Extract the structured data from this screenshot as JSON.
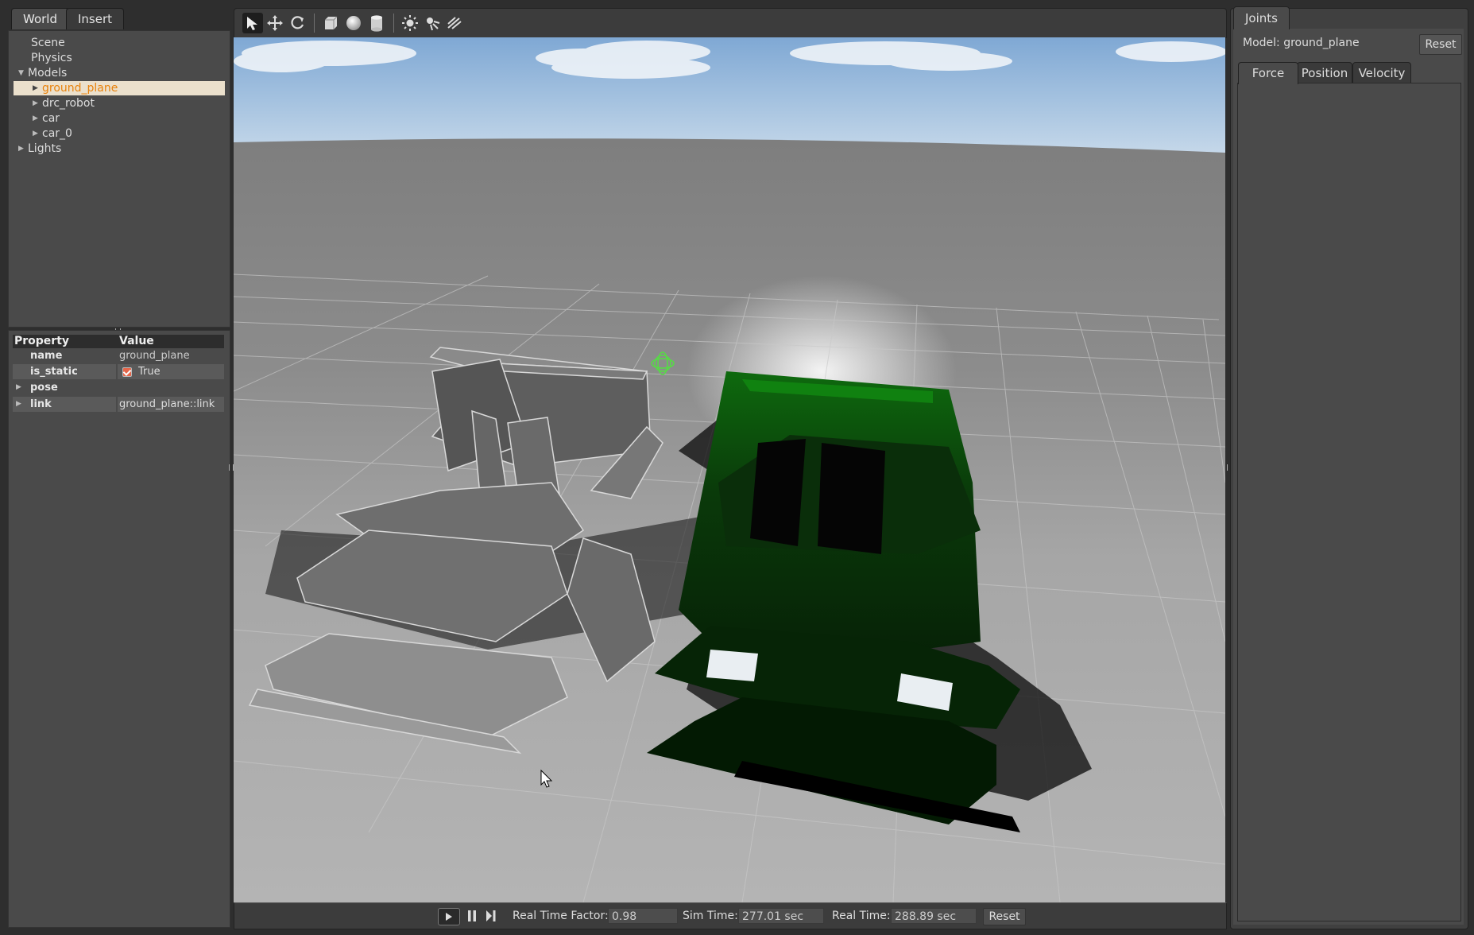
{
  "left_panel": {
    "tabs": [
      "World",
      "Insert"
    ],
    "tree": {
      "scene": "Scene",
      "physics": "Physics",
      "models": "Models",
      "model_items": [
        "ground_plane",
        "drc_robot",
        "car",
        "car_0"
      ],
      "lights": "Lights"
    },
    "properties": {
      "header_property": "Property",
      "header_value": "Value",
      "rows": [
        {
          "name": "name",
          "value": "ground_plane"
        },
        {
          "name": "is_static",
          "value": "True"
        },
        {
          "name": "pose",
          "value": ""
        },
        {
          "name": "link",
          "value": "ground_plane::link"
        }
      ]
    }
  },
  "toolbar": {
    "icons": [
      "select-arrow-icon",
      "translate-icon",
      "rotate-icon",
      "box-icon",
      "sphere-icon",
      "cylinder-icon",
      "point-light-icon",
      "spot-light-icon",
      "directional-light-icon"
    ]
  },
  "status_bar": {
    "real_time_factor_label": "Real Time Factor:",
    "real_time_factor": "0.98",
    "sim_time_label": "Sim Time:",
    "sim_time": "277.01 sec",
    "real_time_label": "Real Time:",
    "real_time": "288.89 sec",
    "reset": "Reset"
  },
  "right_panel": {
    "tab": "Joints",
    "model_label": "Model: ground_plane",
    "reset": "Reset",
    "joint_tabs": [
      "Force",
      "Position",
      "Velocity"
    ]
  },
  "colors": {
    "selection_text": "#e8820c",
    "selection_bg": "#ebe0cc",
    "panel_bg": "#4a4a4a",
    "green_car": "#0b4d0b",
    "checkbox": "#e5664a"
  }
}
